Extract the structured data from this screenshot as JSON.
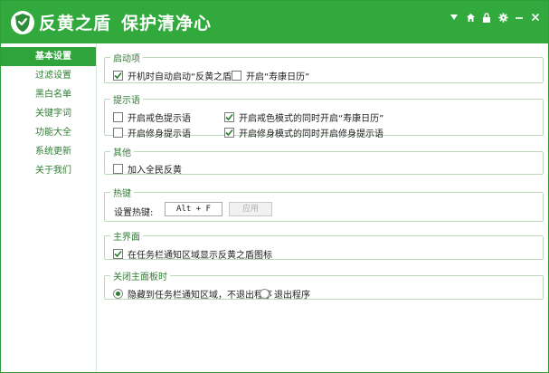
{
  "app": {
    "title": "反黄之盾",
    "slogan": "保护清净心",
    "accent_color": "#31a93c",
    "title_icons": [
      "menu-down-icon",
      "home-icon",
      "lock-icon",
      "settings-icon",
      "minimize-icon",
      "close-icon"
    ]
  },
  "sidebar": {
    "items": [
      {
        "label": "基本设置",
        "active": true
      },
      {
        "label": "过滤设置",
        "active": false
      },
      {
        "label": "黑白名单",
        "active": false
      },
      {
        "label": "关键字词",
        "active": false
      },
      {
        "label": "功能大全",
        "active": false
      },
      {
        "label": "系统更新",
        "active": false
      },
      {
        "label": "关于我们",
        "active": false
      }
    ]
  },
  "groups": {
    "startup": {
      "title": "启动项",
      "auto_start": {
        "label": "开机时自动启动“反黄之盾”",
        "checked": true
      },
      "calendar": {
        "label": "开启“寿康日历”",
        "checked": false
      }
    },
    "prompt": {
      "title": "提示语",
      "abstain": {
        "label": "开启戒色提示语",
        "checked": false
      },
      "cultivate": {
        "label": "开启修身提示语",
        "checked": false
      },
      "abstain_calendar": {
        "label": "开启戒色模式的同时开启“寿康日历”",
        "checked": true
      },
      "cultivate_prompt": {
        "label": "开启修身模式的同时开启修身提示语",
        "checked": true
      }
    },
    "other": {
      "title": "其他",
      "join": {
        "label": "加入全民反黄",
        "checked": false
      }
    },
    "hotkey": {
      "title": "热键",
      "label": "设置热键:",
      "value": "Alt + F",
      "apply_label": "应用"
    },
    "main_ui": {
      "title": "主界面",
      "tray_icon": {
        "label": "在任务栏通知区域显示反黄之盾图标",
        "checked": true
      }
    },
    "close_action": {
      "title": "关闭主面板时",
      "hide": {
        "label": "隐藏到任务栏通知区域，不退出程序",
        "selected": true
      },
      "exit": {
        "label": "退出程序",
        "selected": false
      }
    }
  }
}
